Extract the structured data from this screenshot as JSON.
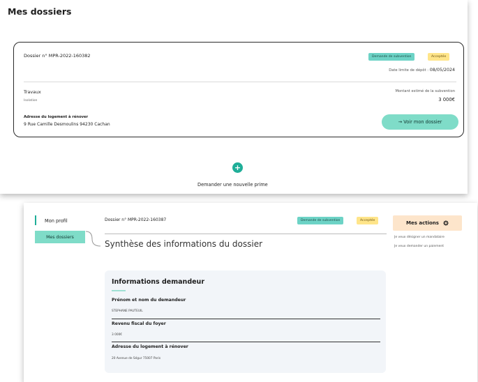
{
  "screen1": {
    "title": "Mes dossiers",
    "card": {
      "dossier_number": "Dossier n° MPR-2022-160382",
      "badge_type": "Demande de subvention",
      "badge_status": "Acceptée",
      "limit_label": "Date limite de dépôt :",
      "limit_date": "08/05/2024",
      "travaux_label": "Travaux",
      "travaux_value": "Isolation",
      "montant_label": "Montant estimé de la subvention",
      "montant_value": "3 000€",
      "address_label": "Adresse du logement à rénover",
      "address_value": "9 Rue Camille Desmoulins 94230 Cachan",
      "button_label": "→ Voir mon dossier"
    },
    "new_prime_label": "Demander une nouvelle prime"
  },
  "screen2": {
    "nav": {
      "profil": "Mon profil",
      "dossiers": "Mes dossiers"
    },
    "dossier_number": "Dossier n° MPR-2022-160387",
    "badge_type": "Demande de subvention",
    "badge_status": "Acceptée",
    "section_title": "Synthèse des informations du dossier",
    "actions": {
      "title": "Mes actions",
      "icon": "gear-icon",
      "link1": "Je veux désigner un mandataire",
      "link2": "Je veux demander un paiement"
    },
    "info": {
      "title": "Informations demandeur",
      "fields": [
        {
          "label": "Prénom et nom du demandeur",
          "value": "STEPHANE PAUTEUIL"
        },
        {
          "label": "Revenu fiscal du foyer",
          "value": "3 000€"
        },
        {
          "label": "Adresse du logement à rénover",
          "value": "20 Avenue de Ségur 75007 Paris"
        }
      ]
    }
  },
  "colors": {
    "accent_teal": "#7fdcc8",
    "badge_teal": "#6dd3c6",
    "badge_yellow": "#ffe58a",
    "actions_bg": "#fde5cb",
    "plus_green": "#1fae98"
  }
}
